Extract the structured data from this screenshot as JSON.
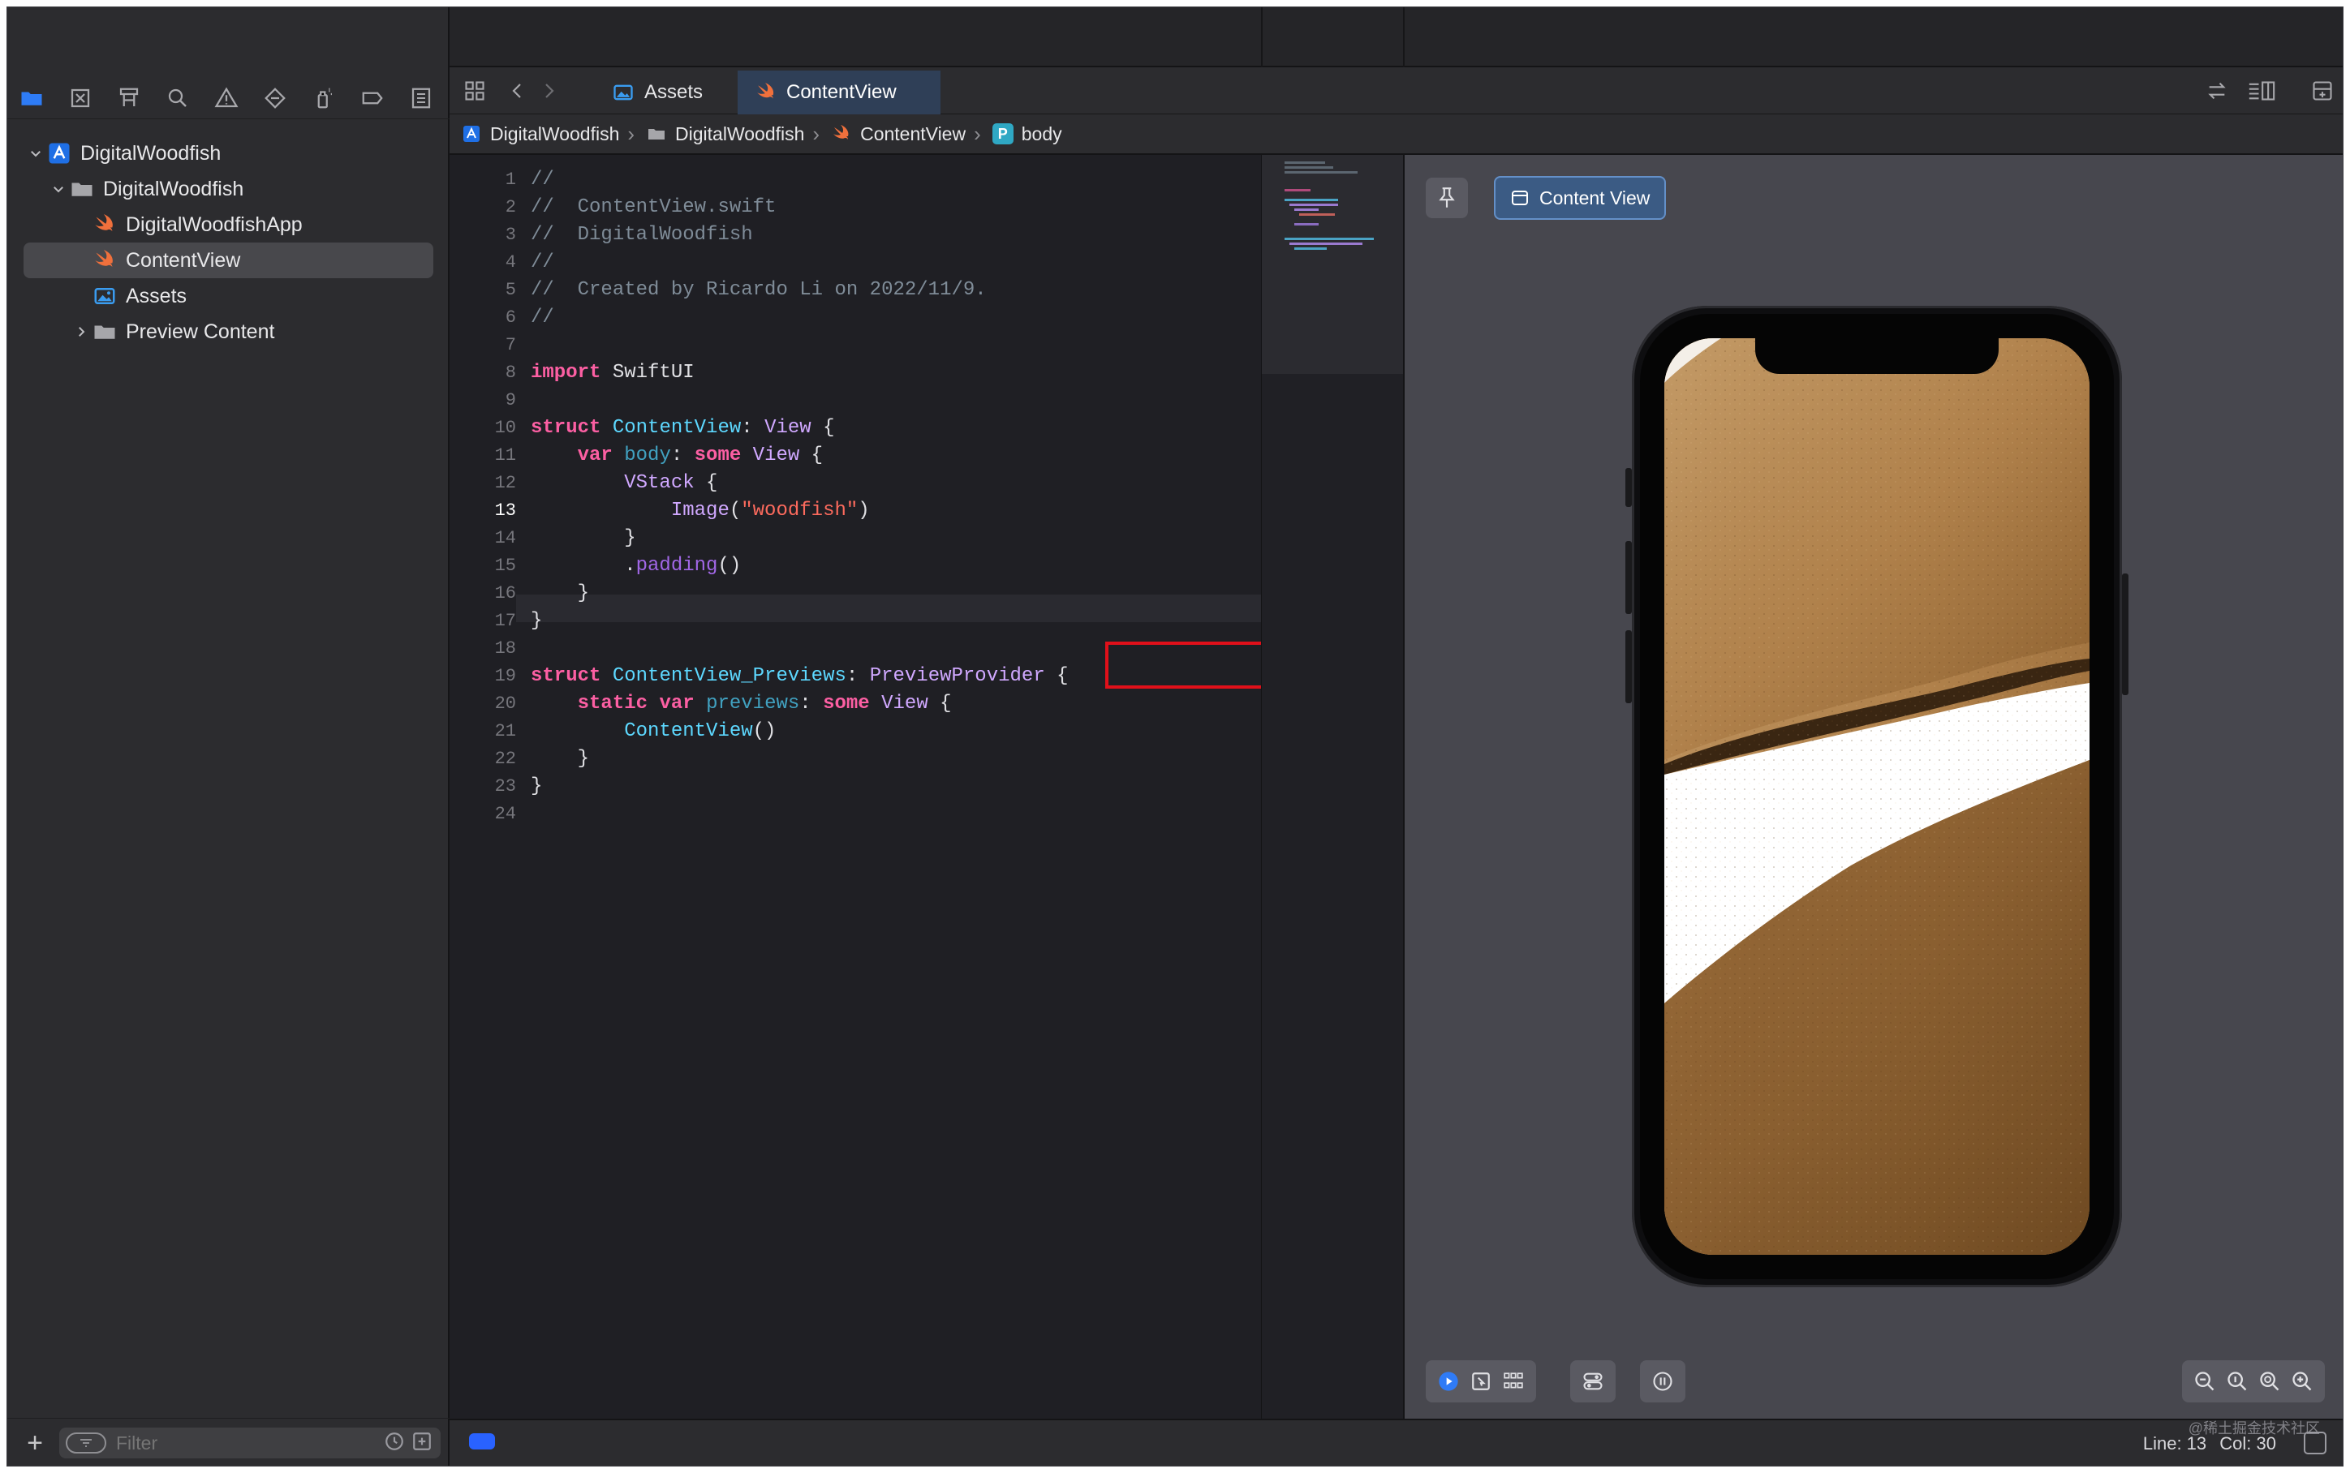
{
  "navigator": {
    "project": "DigitalWoodfish",
    "group": "DigitalWoodfish",
    "files": [
      "DigitalWoodfishApp",
      "ContentView",
      "Assets",
      "Preview Content"
    ],
    "filter_placeholder": "Filter"
  },
  "tabs": {
    "assets": "Assets",
    "content_view": "ContentView"
  },
  "breadcrumb": {
    "project": "DigitalWoodfish",
    "group": "DigitalWoodfish",
    "file": "ContentView",
    "symbol_badge": "P",
    "symbol": "body"
  },
  "code": {
    "line_numbers": [
      "1",
      "2",
      "3",
      "4",
      "5",
      "6",
      "7",
      "8",
      "9",
      "10",
      "11",
      "12",
      "13",
      "14",
      "15",
      "16",
      "17",
      "18",
      "19",
      "20",
      "21",
      "22",
      "23",
      "24"
    ],
    "current_line": "13",
    "lines": [
      [
        {
          "t": "//",
          "c": "comment"
        }
      ],
      [
        {
          "t": "//  ContentView.swift",
          "c": "comment"
        }
      ],
      [
        {
          "t": "//  DigitalWoodfish",
          "c": "comment"
        }
      ],
      [
        {
          "t": "//",
          "c": "comment"
        }
      ],
      [
        {
          "t": "//  Created by Ricardo Li on 2022/11/9.",
          "c": "comment"
        }
      ],
      [
        {
          "t": "//",
          "c": "comment"
        }
      ],
      [],
      [
        {
          "t": "import",
          "c": "kw"
        },
        {
          "t": " SwiftUI",
          "c": "plain"
        }
      ],
      [],
      [
        {
          "t": "struct",
          "c": "kw"
        },
        {
          "t": " ",
          "c": "plain"
        },
        {
          "t": "ContentView",
          "c": "type"
        },
        {
          "t": ": ",
          "c": "plain"
        },
        {
          "t": "View",
          "c": "sys"
        },
        {
          "t": " {",
          "c": "plain"
        }
      ],
      [
        {
          "t": "    ",
          "c": "plain"
        },
        {
          "t": "var",
          "c": "kw"
        },
        {
          "t": " ",
          "c": "plain"
        },
        {
          "t": "body",
          "c": "var"
        },
        {
          "t": ": ",
          "c": "plain"
        },
        {
          "t": "some",
          "c": "kw"
        },
        {
          "t": " ",
          "c": "plain"
        },
        {
          "t": "View",
          "c": "sys"
        },
        {
          "t": " {",
          "c": "plain"
        }
      ],
      [
        {
          "t": "        ",
          "c": "plain"
        },
        {
          "t": "VStack",
          "c": "sys"
        },
        {
          "t": " {",
          "c": "plain"
        }
      ],
      [
        {
          "t": "            ",
          "c": "plain"
        },
        {
          "t": "Image",
          "c": "sys"
        },
        {
          "t": "(",
          "c": "plain"
        },
        {
          "t": "\"woodfish\"",
          "c": "str"
        },
        {
          "t": ")",
          "c": "plain"
        }
      ],
      [
        {
          "t": "        }",
          "c": "plain"
        }
      ],
      [
        {
          "t": "        .",
          "c": "plain"
        },
        {
          "t": "padding",
          "c": "fn"
        },
        {
          "t": "()",
          "c": "plain"
        }
      ],
      [
        {
          "t": "    }",
          "c": "plain"
        }
      ],
      [
        {
          "t": "}",
          "c": "plain"
        }
      ],
      [],
      [
        {
          "t": "struct",
          "c": "kw"
        },
        {
          "t": " ",
          "c": "plain"
        },
        {
          "t": "ContentView_Previews",
          "c": "type"
        },
        {
          "t": ": ",
          "c": "plain"
        },
        {
          "t": "PreviewProvider",
          "c": "sys"
        },
        {
          "t": " {",
          "c": "plain"
        }
      ],
      [
        {
          "t": "    ",
          "c": "plain"
        },
        {
          "t": "static",
          "c": "kw"
        },
        {
          "t": " ",
          "c": "plain"
        },
        {
          "t": "var",
          "c": "kw"
        },
        {
          "t": " ",
          "c": "plain"
        },
        {
          "t": "previews",
          "c": "var"
        },
        {
          "t": ": ",
          "c": "plain"
        },
        {
          "t": "some",
          "c": "kw"
        },
        {
          "t": " ",
          "c": "plain"
        },
        {
          "t": "View",
          "c": "sys"
        },
        {
          "t": " {",
          "c": "plain"
        }
      ],
      [
        {
          "t": "        ",
          "c": "plain"
        },
        {
          "t": "ContentView",
          "c": "type"
        },
        {
          "t": "()",
          "c": "plain"
        }
      ],
      [
        {
          "t": "    }",
          "c": "plain"
        }
      ],
      [
        {
          "t": "}",
          "c": "plain"
        }
      ],
      []
    ]
  },
  "canvas": {
    "preview_button": "Content View"
  },
  "status": {
    "line": "Line: 13",
    "col": "Col: 30",
    "watermark": "@稀土掘金技术社区"
  },
  "colors": {
    "accent": "#2962ff",
    "annotation": "#e0101a",
    "swift_orange": "#f0703c"
  }
}
